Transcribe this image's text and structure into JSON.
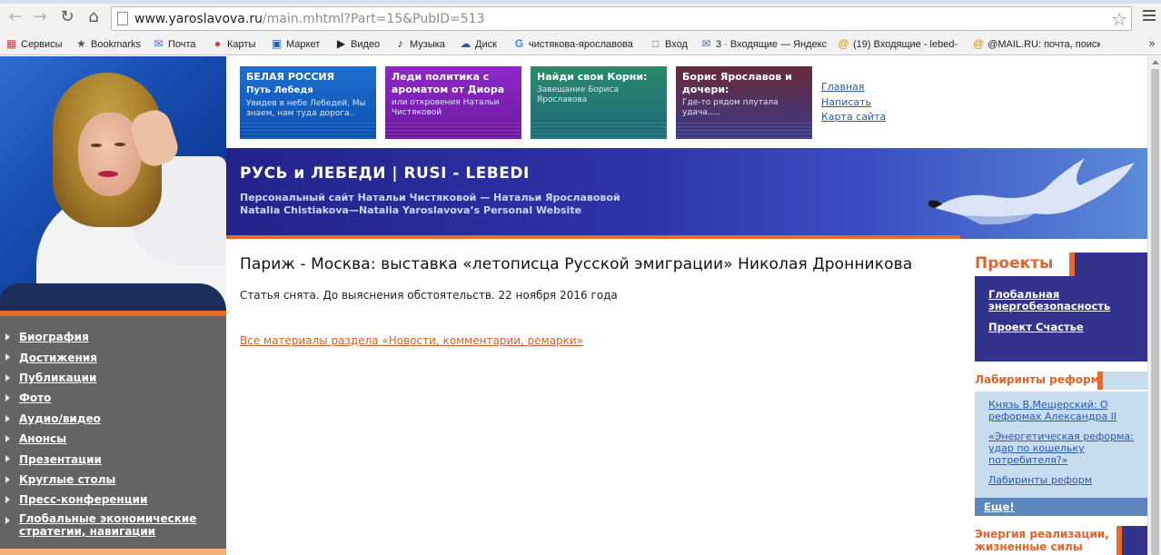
{
  "browser": {
    "url_host": "www.yaroslavova.ru",
    "url_path": "/main.mhtml?Part=15&PubID=513",
    "bookmarks": [
      {
        "label": "Сервисы",
        "icon": "apps-icon"
      },
      {
        "label": "Bookmarks",
        "icon": "star-icon"
      },
      {
        "label": "Почта",
        "icon": "mail-icon"
      },
      {
        "label": "Карты",
        "icon": "map-pin-icon"
      },
      {
        "label": "Маркет",
        "icon": "cart-icon"
      },
      {
        "label": "Видео",
        "icon": "video-icon"
      },
      {
        "label": "Музыка",
        "icon": "music-icon"
      },
      {
        "label": "Диск",
        "icon": "disk-icon"
      },
      {
        "label": "чистякова-ярославова",
        "icon": "google-icon"
      },
      {
        "label": "Вход",
        "icon": "page-icon"
      },
      {
        "label": "3 · Входящие — Яндекс",
        "icon": "mail-icon"
      },
      {
        "label": "(19) Входящие - lebed-",
        "icon": "at-icon"
      },
      {
        "label": "@MAIL.RU: почта, поиск",
        "icon": "at-icon"
      }
    ],
    "more": "»"
  },
  "tiles": [
    {
      "title": "БЕЛАЯ РОССИЯ\nПуть Лебедя",
      "text": "Увидев в небе Лебедей, Мы знаем, нам туда дорога..",
      "color": "#1e6fd0"
    },
    {
      "title": "Леди политика с ароматом от Диора",
      "text": "или откровения Натальи Чистяковой",
      "color": "#8f28c9"
    },
    {
      "title": "Найди свои Корни:",
      "text": "Завещание Бориса Ярославова",
      "color": "#2b8a6a"
    },
    {
      "title": "Борис Ярославов и дочери:",
      "text": "Где-то рядом плутала удача.....",
      "color": "#6a2a3a"
    }
  ],
  "top_links": [
    "Главная",
    "Написать",
    "Карта сайта"
  ],
  "hero": {
    "title": "РУСЬ и ЛЕБЕДИ | RUSI - LEBEDI",
    "subtitle_ru": "Персональный сайт Натальи Чистяковой — Натальи Ярославовой",
    "subtitle_en": "Natalia Chistiakova—Natalia Yaroslavova’s  Personal Website"
  },
  "left_nav": [
    "Биография",
    "Достижения",
    "Публикации",
    "Фото",
    "Аудио/видео",
    "Анонсы",
    "Презентации",
    "Круглые столы",
    "Пресс-конференции",
    "Глобальные экономические стратегии, навигации"
  ],
  "article": {
    "title": "Париж - Москва: выставка «летописца Русской эмиграции» Николая Дронникова",
    "note": "Статья снята. До выяснения обстоятельств. 22 ноября 2016 года",
    "more_link": "Все материалы раздела «Новости, комментарии, ремарки»"
  },
  "sidebar": {
    "projects_title": "Проекты",
    "projects": [
      "Глобальная энергобезопасность",
      "Проект Счастье"
    ],
    "labyrinths_title": "Лабиринты реформ",
    "labyrinths": [
      "Князь В.Мещерский: О реформах Александра II",
      "«Энергетическая реформа: удар по кошельку потребителя?»",
      "Лабиринты реформ"
    ],
    "more_label": "Еще!",
    "energy_title": "Энергия реализации, жизненные силы"
  },
  "colors": {
    "accent_orange": "#ea6a2b",
    "nav_gray": "#646464",
    "navy": "#33338c",
    "link_blue": "#2a5aa8"
  }
}
